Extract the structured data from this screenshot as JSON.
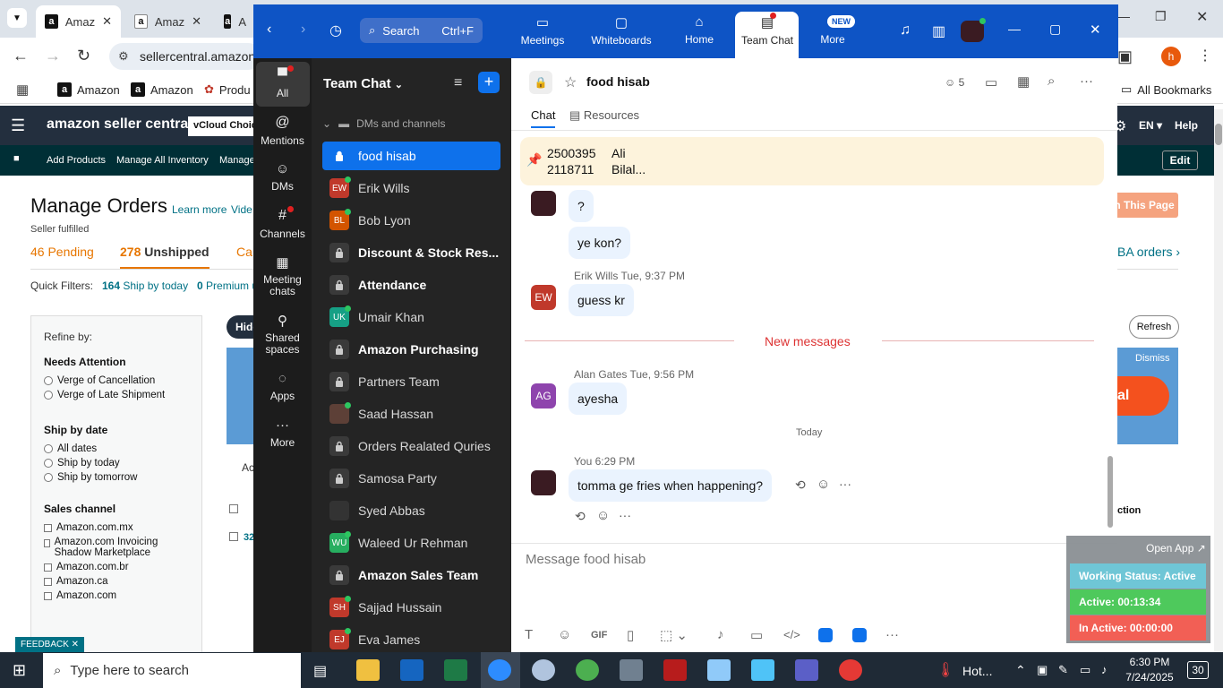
{
  "chrome": {
    "tabs": [
      {
        "label": "Amaz"
      },
      {
        "label": "Amaz"
      },
      {
        "label": "A"
      }
    ],
    "url": "sellercentral.amazon",
    "bookmarks": [
      "Amazon",
      "Amazon",
      "Produ"
    ],
    "all_bookmarks": "All Bookmarks",
    "profile_initial": "h"
  },
  "amazon": {
    "logo": "amazon seller central",
    "vcloud": "vCloud Choic",
    "lang": "EN",
    "help": "Help",
    "nav": [
      "Add Products",
      "Manage All Inventory",
      "Manage"
    ],
    "edit": "Edit",
    "page_title": "Manage Orders",
    "learn_more": "Learn more",
    "video": "Vide",
    "seller_fulfilled": "Seller fulfilled",
    "pending": "46 Pending",
    "unshipped_count": "278",
    "unshipped_label": "Unshipped",
    "canceled": "Ca",
    "fba_orders": "BA orders ›",
    "this_page": "n This Page",
    "quick_filters": "Quick Filters:",
    "ship_today_count": "164",
    "ship_today_label": "Ship by today",
    "premium_count": "0",
    "premium_label": "Premium u",
    "hide": "Hide",
    "refresh": "Refresh",
    "dismiss": "Dismiss",
    "banner_fragment": "al",
    "action_fragment": "Ac",
    "action_col": "ction",
    "order_row_text": "32",
    "refine": {
      "title": "Refine by:",
      "sections": [
        {
          "title": "Needs Attention",
          "type": "radio",
          "options": [
            "Verge of Cancellation",
            "Verge of Late Shipment"
          ]
        },
        {
          "title": "Ship by date",
          "type": "radio",
          "options": [
            "All dates",
            "Ship by today",
            "Ship by tomorrow"
          ]
        },
        {
          "title": "Sales channel",
          "type": "check",
          "options": [
            "Amazon.com.mx",
            "Amazon.com Invoicing Shadow Marketplace",
            "Amazon.com.br",
            "Amazon.ca",
            "Amazon.com"
          ]
        }
      ]
    },
    "feedback": "FEEDBACK ✕"
  },
  "zoom": {
    "search_label": "Search",
    "search_shortcut": "Ctrl+F",
    "top_nav": [
      {
        "label": "Meetings",
        "icon": "video-icon"
      },
      {
        "label": "Whiteboards",
        "icon": "whiteboard-icon"
      },
      {
        "label": "Home",
        "icon": "home-icon"
      },
      {
        "label": "Team Chat",
        "icon": "chat-icon"
      },
      {
        "label": "More",
        "icon": "more-icon"
      }
    ],
    "new_badge": "NEW",
    "left_nav": [
      {
        "label": "All"
      },
      {
        "label": "Mentions"
      },
      {
        "label": "DMs"
      },
      {
        "label": "Channels"
      },
      {
        "label": "Meeting chats"
      },
      {
        "label": "Shared spaces"
      },
      {
        "label": "Apps"
      },
      {
        "label": "More"
      }
    ],
    "list_title": "Team Chat",
    "section_label": "DMs and channels",
    "items": [
      {
        "name": "food hisab",
        "kind": "lock",
        "bold": false,
        "active": true
      },
      {
        "name": "Erik Wills",
        "kind": "avatar",
        "initials": "EW",
        "color": "#c0392b",
        "online": true
      },
      {
        "name": "Bob Lyon",
        "kind": "avatar",
        "initials": "BL",
        "color": "#d35400",
        "online": true
      },
      {
        "name": "Discount & Stock Res...",
        "kind": "lock",
        "bold": true
      },
      {
        "name": "Attendance",
        "kind": "lock",
        "bold": true
      },
      {
        "name": "Umair Khan",
        "kind": "avatar",
        "initials": "UK",
        "color": "#16a085",
        "online": true
      },
      {
        "name": "Amazon Purchasing",
        "kind": "lock",
        "bold": true
      },
      {
        "name": "Partners Team",
        "kind": "lock",
        "bold": false
      },
      {
        "name": "Saad Hassan",
        "kind": "avatar",
        "initials": "",
        "color": "#5d4037",
        "online": true
      },
      {
        "name": "Orders Realated Quries",
        "kind": "lock",
        "bold": false
      },
      {
        "name": "Samosa Party",
        "kind": "lock",
        "bold": false
      },
      {
        "name": "Syed Abbas",
        "kind": "avatar",
        "initials": "",
        "color": "#333333",
        "online": false
      },
      {
        "name": "Waleed Ur Rehman",
        "kind": "avatar",
        "initials": "WU",
        "color": "#27ae60",
        "online": true
      },
      {
        "name": "Amazon Sales Team",
        "kind": "lock",
        "bold": true
      },
      {
        "name": "Sajjad Hussain",
        "kind": "avatar",
        "initials": "SH",
        "color": "#c0392b",
        "online": true
      },
      {
        "name": "Eva James",
        "kind": "avatar",
        "initials": "EJ",
        "color": "#c0392b",
        "online": true
      }
    ],
    "chat": {
      "title": "food hisab",
      "members": "5",
      "tab_chat": "Chat",
      "tab_resources": "Resources",
      "pinned": [
        {
          "num": "2500395",
          "name": "Ali"
        },
        {
          "num": "2118711",
          "name": "Bilal..."
        }
      ],
      "msg_q": "?",
      "msg_kon": "ye kon?",
      "erik_name": "Erik Wills",
      "erik_time": "Tue, 9:37 PM",
      "erik_initials": "EW",
      "erik_msg": "guess kr",
      "new_messages": "New messages",
      "alan_name": "Alan Gates",
      "alan_time": "Tue, 9:56 PM",
      "alan_initials": "AG",
      "alan_msg": "ayesha",
      "today": "Today",
      "you_name": "You",
      "you_time": "6:29 PM",
      "you_msg": "tomma ge fries when happening?",
      "input_placeholder": "Message food hisab",
      "gif": "GIF"
    }
  },
  "tracker": {
    "open_app": "Open App ↗",
    "working": "Working Status: Active",
    "active": "Active: 00:13:34",
    "inactive": "In Active: 00:00:00"
  },
  "taskbar": {
    "search": "Type here to search",
    "weather": "Hot...",
    "time": "6:30 PM",
    "date": "7/24/2025",
    "notif_count": "30"
  }
}
